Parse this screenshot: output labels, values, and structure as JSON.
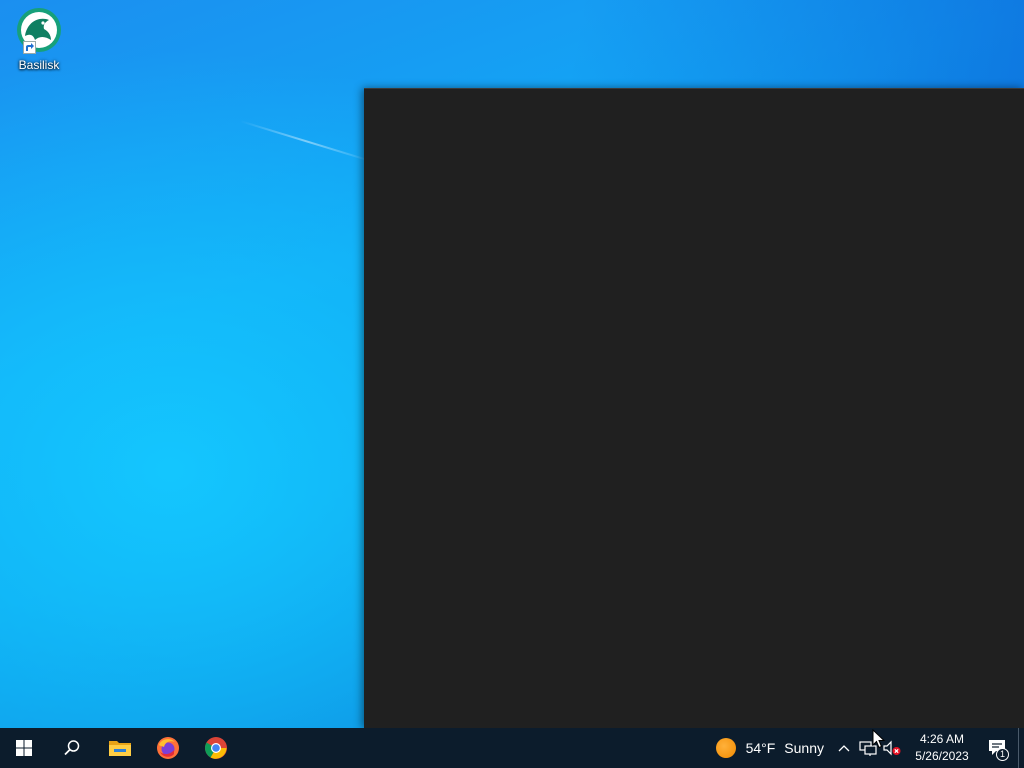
{
  "desktop": {
    "icons": [
      {
        "label": "Basilisk",
        "icon": "basilisk-browser-icon"
      }
    ]
  },
  "window": {
    "theme_color": "#202020"
  },
  "taskbar": {
    "items": [
      {
        "name": "start",
        "icon": "windows-logo-icon"
      },
      {
        "name": "search",
        "icon": "search-icon"
      },
      {
        "name": "file-explorer",
        "icon": "folder-icon"
      },
      {
        "name": "firefox",
        "icon": "firefox-icon"
      },
      {
        "name": "chrome",
        "icon": "chrome-icon"
      }
    ],
    "weather": {
      "icon": "sun-icon",
      "temperature": "54°F",
      "condition": "Sunny"
    },
    "tray_icons": [
      "chevron-up-icon",
      "network-icon",
      "volume-muted-icon"
    ],
    "clock": {
      "time": "4:26 AM",
      "date": "5/26/2023"
    },
    "notifications": {
      "icon": "action-center-icon",
      "count": "1"
    }
  },
  "colors": {
    "taskbar": "#0c1c2c",
    "window": "#202020",
    "accent": "#0078d7"
  }
}
